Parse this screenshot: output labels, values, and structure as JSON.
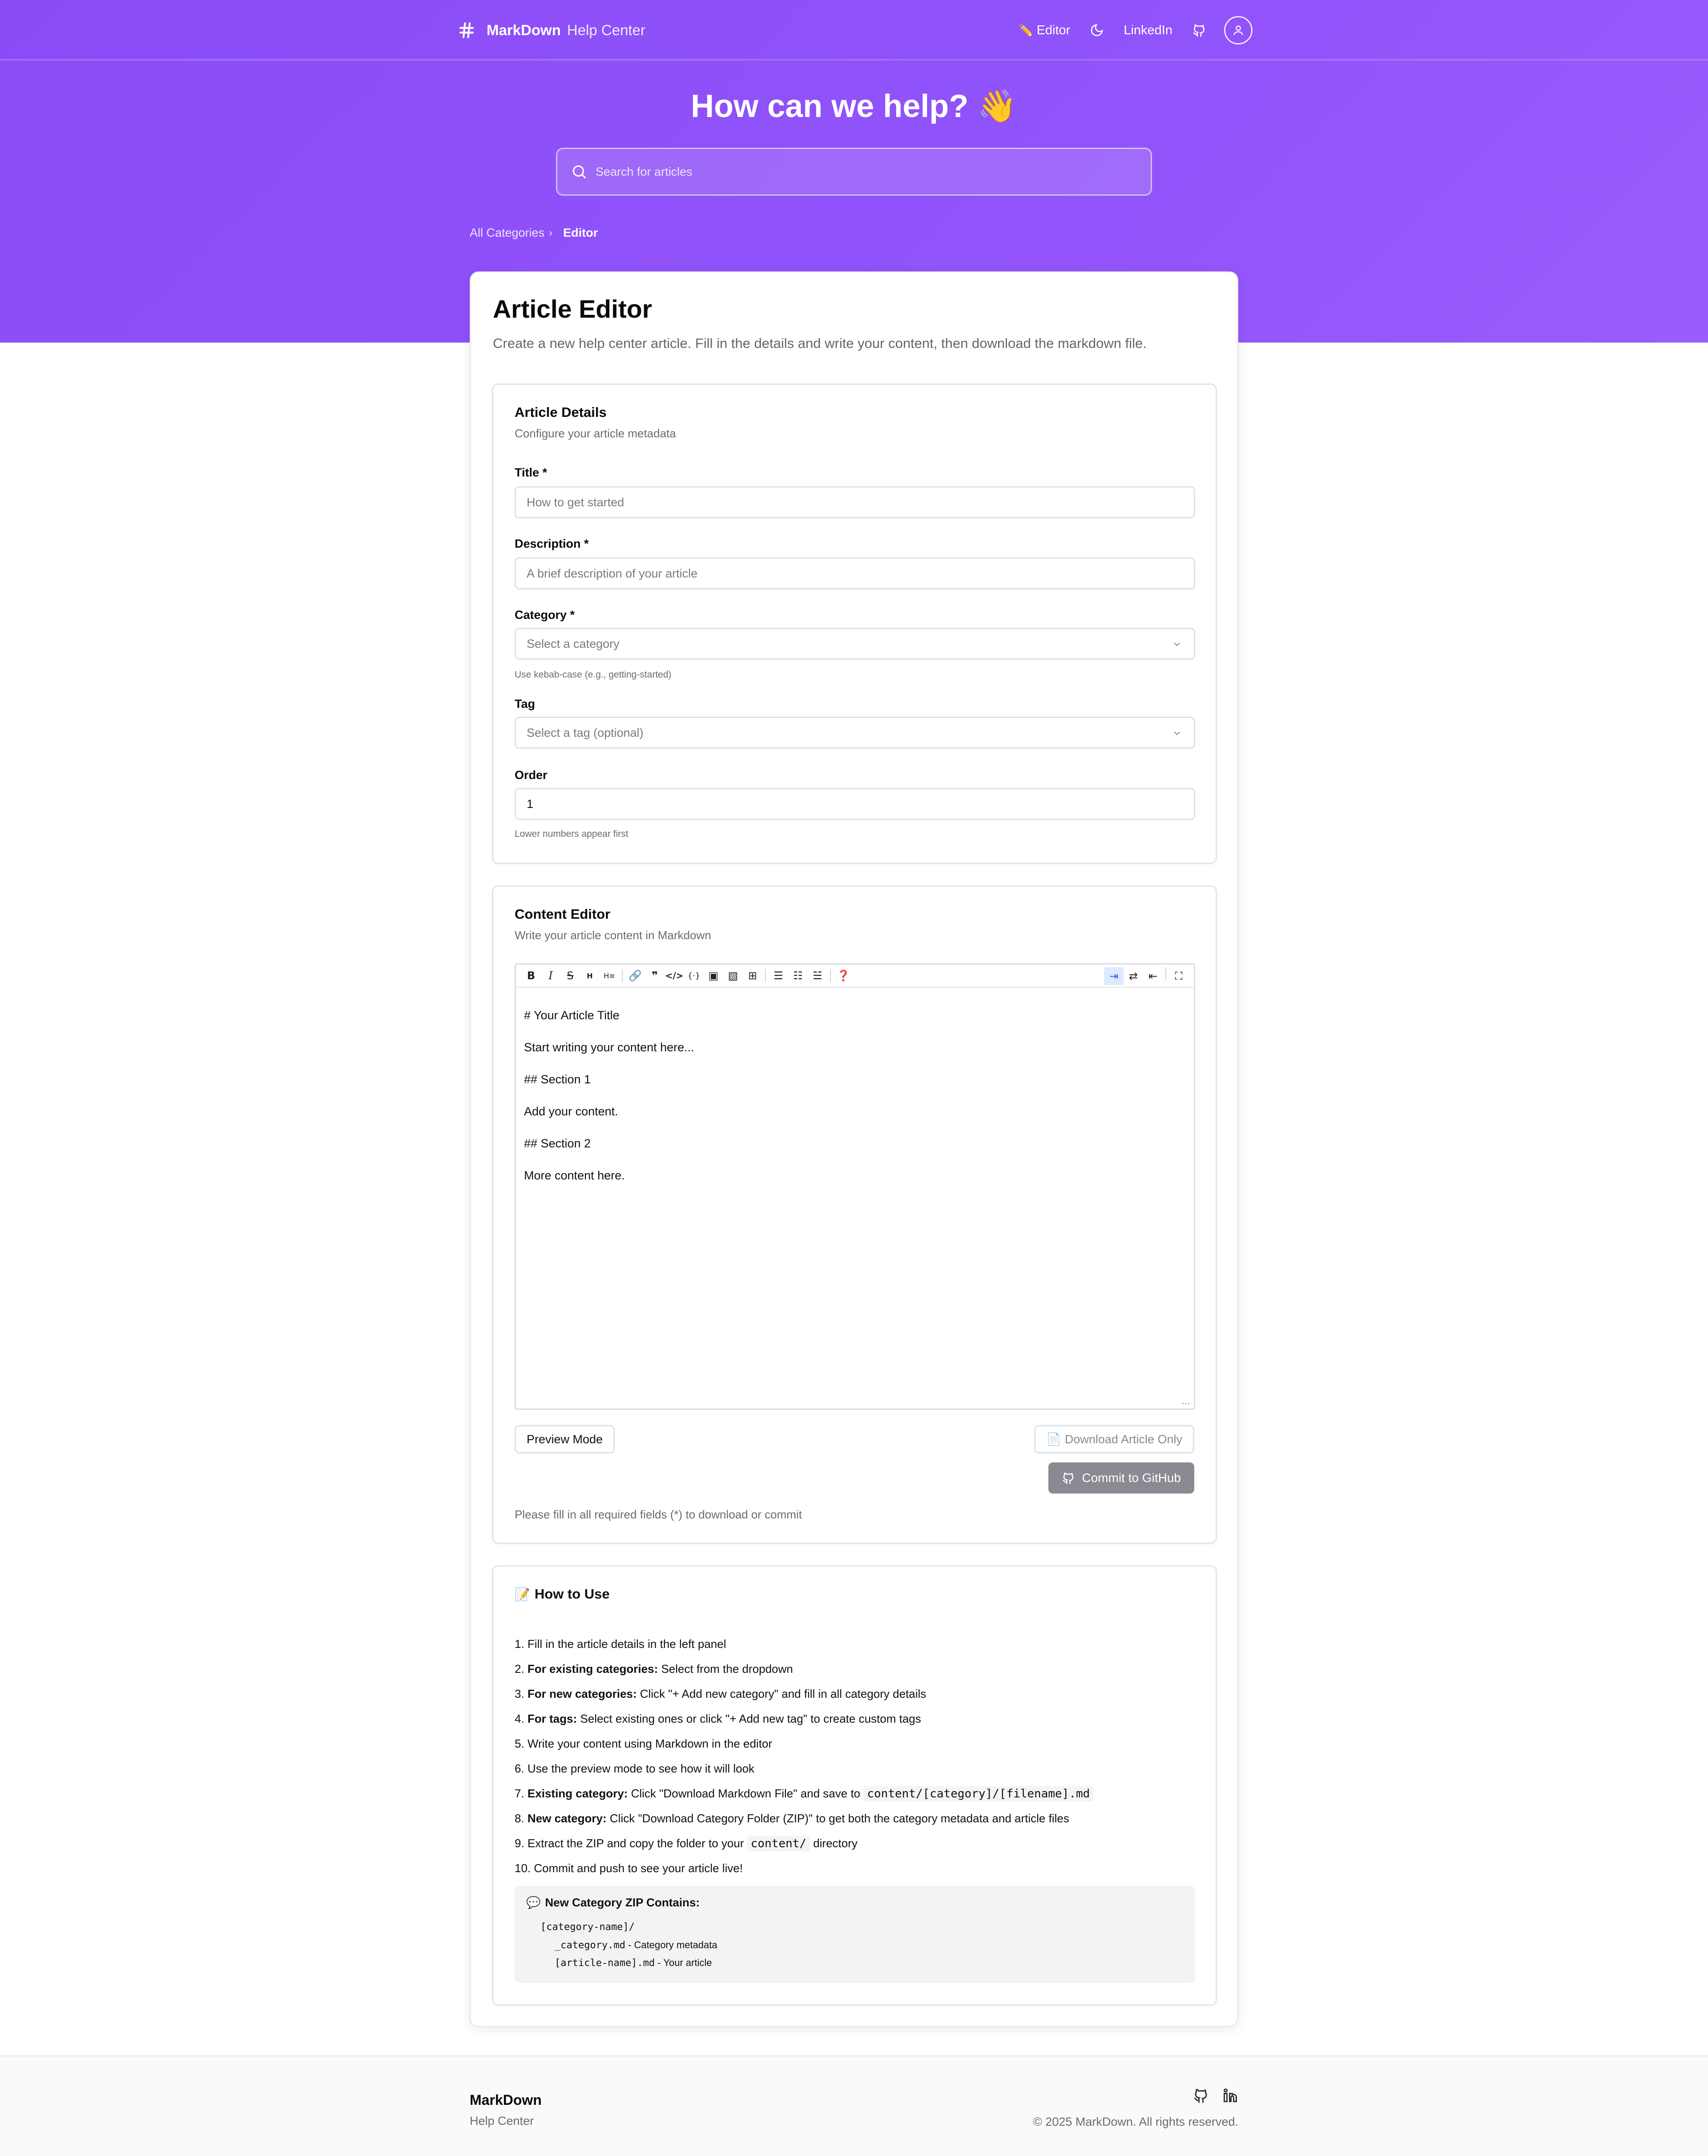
{
  "header": {
    "brand_name": "MarkDown",
    "brand_sub": "Help Center",
    "nav": {
      "editor": "Editor",
      "linkedin": "LinkedIn"
    }
  },
  "hero": {
    "title": "How can we help? 👋",
    "search_placeholder": "Search for articles"
  },
  "breadcrumb": {
    "root": "All Categories",
    "current": "Editor"
  },
  "page": {
    "title": "Article Editor",
    "description": "Create a new help center article. Fill in the details and write your content, then download the markdown file."
  },
  "details": {
    "title": "Article Details",
    "subtitle": "Configure your article metadata",
    "title_label": "Title *",
    "title_placeholder": "How to get started",
    "description_label": "Description *",
    "description_placeholder": "A brief description of your article",
    "category_label": "Category *",
    "category_placeholder": "Select a category",
    "category_hint": "Use kebab-case (e.g., getting-started)",
    "tag_label": "Tag",
    "tag_placeholder": "Select a tag (optional)",
    "order_label": "Order",
    "order_value": "1",
    "order_hint": "Lower numbers appear first"
  },
  "content": {
    "title": "Content Editor",
    "subtitle": "Write your article content in Markdown",
    "lines": [
      "# Your Article Title",
      "Start writing your content here...",
      "## Section 1",
      "Add your content.",
      "## Section 2",
      "More content here."
    ],
    "preview_button": "Preview Mode",
    "download_button": "Download Article Only",
    "github_button": "Commit to GitHub",
    "status": "Please fill in all required fields (*) to download or commit"
  },
  "how_to": {
    "title": "How to Use",
    "steps": [
      {
        "n": "1.",
        "bold": "",
        "text": "Fill in the article details in the left panel"
      },
      {
        "n": "2.",
        "bold": "For existing categories:",
        "text": "Select from the dropdown"
      },
      {
        "n": "3.",
        "bold": "For new categories:",
        "text": "Click \"+ Add new category\" and fill in all category details"
      },
      {
        "n": "4.",
        "bold": "For tags:",
        "text": "Select existing ones or click \"+ Add new tag\" to create custom tags"
      },
      {
        "n": "5.",
        "bold": "",
        "text": "Write your content using Markdown in the editor"
      },
      {
        "n": "6.",
        "bold": "",
        "text": "Use the preview mode to see how it will look"
      },
      {
        "n": "7.",
        "bold": "Existing category:",
        "text": "Click \"Download Markdown File\" and save to",
        "code": "content/[category]/[filename].md"
      },
      {
        "n": "8.",
        "bold": "New category:",
        "text": "Click \"Download Category Folder (ZIP)\" to get both the category metadata and article files"
      },
      {
        "n": "9.",
        "bold": "",
        "text": "Extract the ZIP and copy the folder to your",
        "code": "content/",
        "after": "directory"
      },
      {
        "n": "10.",
        "bold": "",
        "text": "Commit and push to see your article live!"
      }
    ],
    "zip": {
      "title": "New Category ZIP Contains:",
      "folder": "[category-name]/",
      "file1": "_category.md",
      "file1_desc": "- Category metadata",
      "file2": "[article-name].md",
      "file2_desc": "- Your article"
    }
  },
  "footer": {
    "brand": "MarkDown",
    "sub": "Help Center",
    "copyright": "© 2025 MarkDown. All rights reserved."
  },
  "colors": {
    "brand_purple": "#8b4cf7",
    "button_disabled": "#8a8a92"
  }
}
